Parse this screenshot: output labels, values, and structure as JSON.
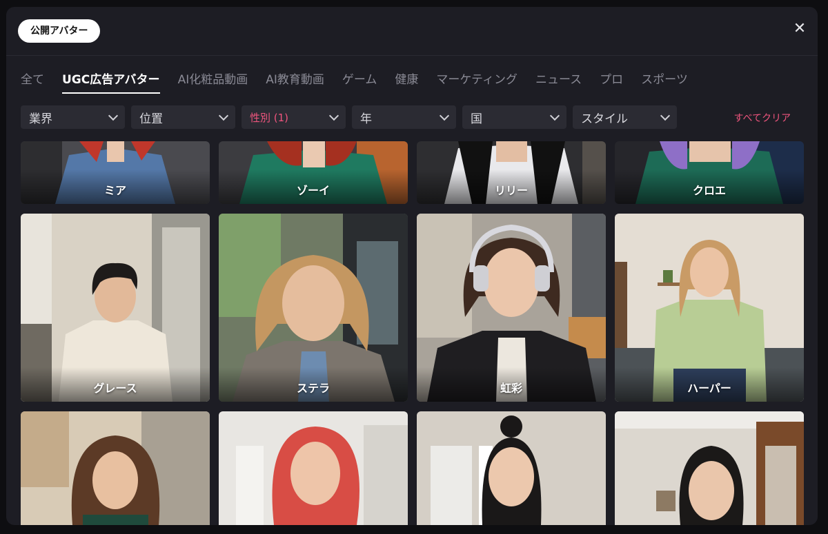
{
  "header": {
    "pill_label": "公開アバター",
    "close_icon": "close-icon"
  },
  "tabs": [
    {
      "label": "全て",
      "active": false
    },
    {
      "label": "UGC広告アバター",
      "active": true
    },
    {
      "label": "AI化粧品動画",
      "active": false
    },
    {
      "label": "AI教育動画",
      "active": false
    },
    {
      "label": "ゲーム",
      "active": false
    },
    {
      "label": "健康",
      "active": false
    },
    {
      "label": "マーケティング",
      "active": false
    },
    {
      "label": "ニュース",
      "active": false
    },
    {
      "label": "プロ",
      "active": false
    },
    {
      "label": "スポーツ",
      "active": false
    }
  ],
  "filters": [
    {
      "label": "業界"
    },
    {
      "label": "位置"
    },
    {
      "label": "性別 (1)"
    },
    {
      "label": "年"
    },
    {
      "label": "国"
    },
    {
      "label": "スタイル"
    }
  ],
  "clear_all": "すべてクリア",
  "accent_color": "#f0557e",
  "avatars_row1": [
    "ミア",
    "ゾーイ",
    "リリー",
    "クロエ"
  ],
  "avatars_row2": [
    "グレース",
    "ステラ",
    "虹彩",
    "ハーパー"
  ],
  "avatars_row3": [
    "",
    "",
    "",
    ""
  ]
}
